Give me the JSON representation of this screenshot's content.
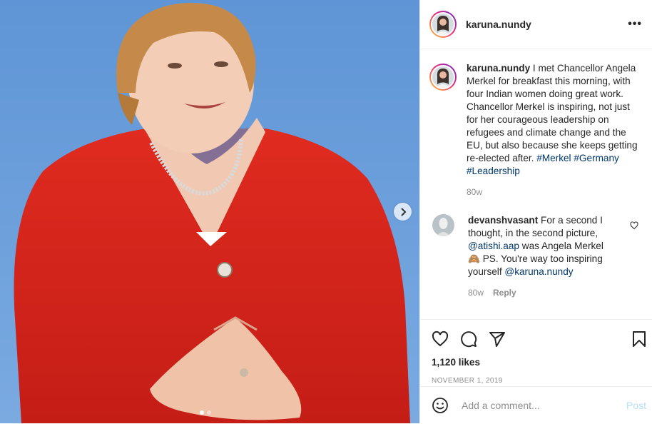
{
  "post": {
    "author": "karuna.nundy",
    "more_label": "•••",
    "caption": {
      "username": "karuna.nundy",
      "text": "I met Chancellor Angela Merkel for breakfast this morning, with four Indian women doing great work. Chancellor Merkel is inspiring, not just for her courageous leadership on refugees and climate change and the EU, but also because she keeps getting re-elected after.",
      "hashtags": [
        "#Merkel",
        "#Germany",
        "#Leadership"
      ],
      "time": "80w"
    },
    "comments": [
      {
        "username": "devanshvasant",
        "text_1": "For a second I thought, in the second picture,",
        "mention_1": "@atishi.aap",
        "text_2": "was Angela Merkel 🙈 PS. You're way too inspiring yourself",
        "mention_2": "@karuna.nundy",
        "time": "80w",
        "reply_label": "Reply"
      }
    ],
    "likes": "1,120 likes",
    "date": "NOVEMBER 1, 2019",
    "add_comment": {
      "placeholder": "Add a comment...",
      "post_label": "Post"
    },
    "carousel": {
      "slides": 2,
      "active": 1
    }
  },
  "colors": {
    "background_blue": "#6f9fd8",
    "jacket_red": "#d9261c",
    "link": "#00376b",
    "muted": "#8e8e8e",
    "post_button": "#b2dffc"
  }
}
